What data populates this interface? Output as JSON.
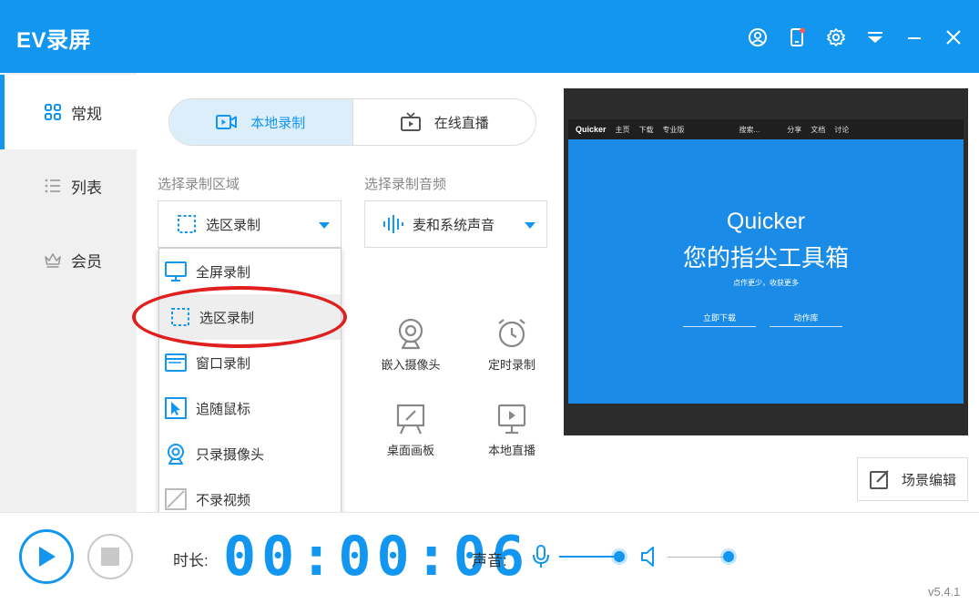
{
  "app": {
    "title": "EV录屏",
    "accent_color": "#1296f0",
    "titlebar_icons": [
      "user-icon",
      "phone-icon",
      "gear-icon",
      "dropdown-menu-icon",
      "minimize-icon",
      "close-icon"
    ]
  },
  "sidebar": {
    "items": [
      {
        "label": "常规",
        "icon": "grid-icon",
        "active": true
      },
      {
        "label": "列表",
        "icon": "list-icon",
        "active": false
      },
      {
        "label": "会员",
        "icon": "crown-icon",
        "active": false
      }
    ]
  },
  "mode_tabs": [
    {
      "label": "本地录制",
      "icon": "video-camera-icon",
      "active": true
    },
    {
      "label": "在线直播",
      "icon": "tv-icon",
      "active": false
    }
  ],
  "record_area": {
    "label": "选择录制区域",
    "selected": "选区录制",
    "options": [
      {
        "label": "全屏录制",
        "icon": "monitor-icon"
      },
      {
        "label": "选区录制",
        "icon": "dashed-square-icon"
      },
      {
        "label": "窗口录制",
        "icon": "window-icon"
      },
      {
        "label": "追随鼠标",
        "icon": "cursor-icon"
      },
      {
        "label": "只录摄像头",
        "icon": "webcam-icon"
      },
      {
        "label": "不录视频",
        "icon": "no-video-icon"
      }
    ]
  },
  "record_audio": {
    "label": "选择录制音频",
    "selected": "麦和系统声音",
    "icon": "audio-wave-icon"
  },
  "tools": [
    {
      "label": "嵌入摄像头",
      "icon": "webcam-icon"
    },
    {
      "label": "定时录制",
      "icon": "alarm-clock-icon"
    },
    {
      "label": "桌面画板",
      "icon": "easel-icon"
    },
    {
      "label": "本地直播",
      "icon": "monitor-play-icon"
    }
  ],
  "preview": {
    "nav_brand": "Quicker",
    "nav_items": [
      "主页",
      "下载",
      "专业版"
    ],
    "nav_search": "搜索...",
    "nav_right_items": [
      "分享",
      "文档",
      "讨论"
    ],
    "headline": "Quicker",
    "subheadline": "您的指尖工具箱",
    "tagline": "点作更少，收获更多",
    "buttons": [
      "立即下载",
      "动作库"
    ]
  },
  "scene_edit": {
    "label": "场景编辑"
  },
  "bottom": {
    "duration_label": "时长:",
    "timer": "00:00:06",
    "sound_label": "声音:",
    "mic_volume": 1.0,
    "speaker_volume": 1.0
  },
  "version": "v5.4.1"
}
